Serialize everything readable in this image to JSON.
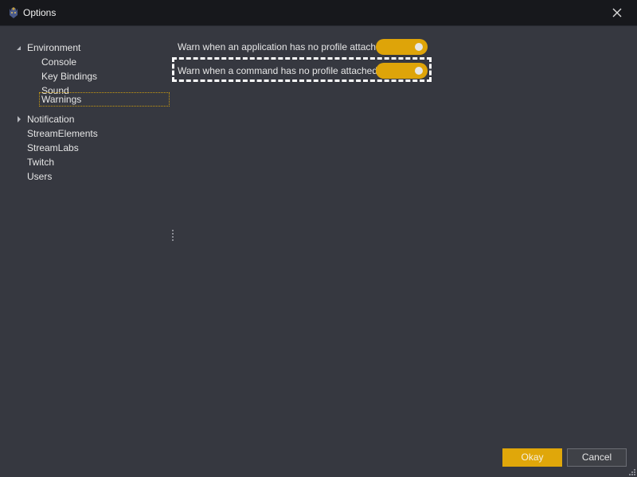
{
  "window": {
    "title": "Options",
    "icon": "app-logo-icon",
    "close_icon": "close-icon"
  },
  "tree": {
    "items": [
      {
        "label": "Environment",
        "expanded": true,
        "level": 0
      },
      {
        "label": "Console",
        "level": 1
      },
      {
        "label": "Key Bindings",
        "level": 1
      },
      {
        "label": "Sound",
        "level": 1
      },
      {
        "label": "Warnings",
        "level": 1,
        "selected": true
      },
      {
        "label": "Notification",
        "expanded": false,
        "level": 0
      },
      {
        "label": "StreamElements",
        "level": 0
      },
      {
        "label": "StreamLabs",
        "level": 0
      },
      {
        "label": "Twitch",
        "level": 0
      },
      {
        "label": "Users",
        "level": 0
      }
    ]
  },
  "settings": [
    {
      "label": "Warn when an application has no profile attached.",
      "enabled": true
    },
    {
      "label": "Warn when a command has no profile attached.",
      "enabled": true,
      "focused": true
    }
  ],
  "footer": {
    "okay_label": "Okay",
    "cancel_label": "Cancel"
  },
  "colors": {
    "accent": "#dea409",
    "background": "#363840",
    "titlebar": "#17181c"
  }
}
